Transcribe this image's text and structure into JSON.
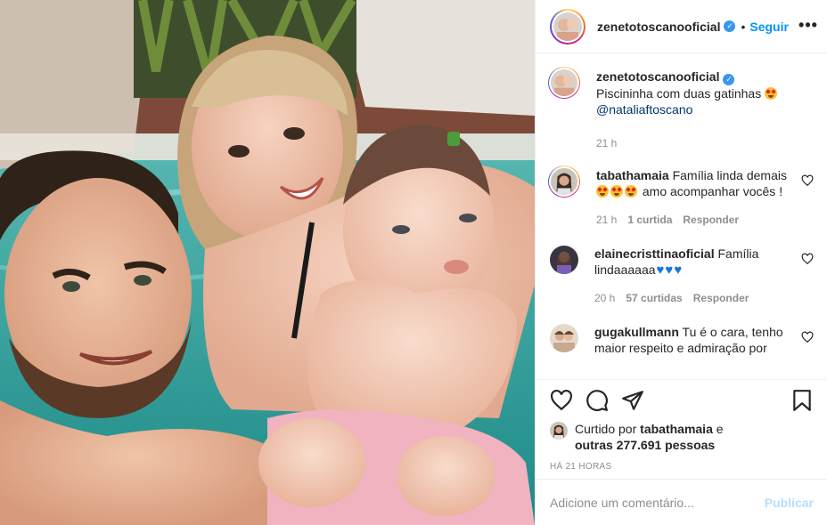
{
  "post": {
    "image_alt": "Selfie of a family in a swimming pool",
    "header": {
      "username": "zenetotoscanooficial",
      "dot": "•",
      "follow_label": "Seguir",
      "more_label": "•••"
    },
    "caption": {
      "username": "zenetotoscanooficial",
      "text": "Piscininha com duas gatinhas",
      "mention": "@nataliaftoscano",
      "time": "21 h"
    },
    "comments": [
      {
        "username": "tabathamaia",
        "text_before": "Família linda demais",
        "text_after": "amo acompanhar vocês !",
        "time": "21 h",
        "likes": "1 curtida",
        "reply": "Responder"
      },
      {
        "username": "elainecristtinaoficial",
        "text_before": "Família lindaaaaaa",
        "time": "20 h",
        "likes": "57 curtidas",
        "reply": "Responder"
      },
      {
        "username": "gugakullmann",
        "text_before": "Tu é o cara, tenho maior respeito e admiração por"
      }
    ],
    "actions": {
      "liked_prefix": "Curtido por",
      "liked_user": "tabathamaia",
      "liked_and": "e",
      "liked_others": "outras 277.691 pessoas",
      "time_ago": "HÁ 21 HORAS"
    },
    "comment_box": {
      "placeholder": "Adicione um comentário...",
      "publish_label": "Publicar"
    },
    "colors": {
      "link_blue": "#0095f6",
      "verified_blue": "#3897f0",
      "mention_blue": "#00376b",
      "muted_gray": "#8e8e8e",
      "publish_disabled": "#b2dffc"
    },
    "icons": [
      "heart-icon",
      "comment-icon",
      "share-icon",
      "bookmark-icon",
      "verified-icon",
      "more-icon"
    ]
  }
}
